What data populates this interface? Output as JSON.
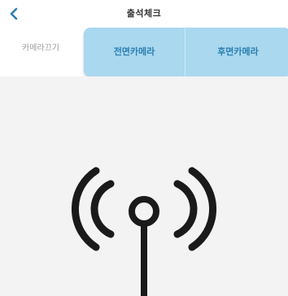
{
  "header": {
    "title": "출석체크",
    "back_icon": "chevron-left-icon"
  },
  "tabs": {
    "camera_off": "카메라끄기",
    "front_camera": "전면카메라",
    "rear_camera": "후면카메라"
  },
  "content": {
    "icon": "antenna-broadcast-icon"
  },
  "colors": {
    "accent": "#2c7fb1",
    "pill_bg": "#a9d8ef",
    "content_bg": "#f3f3f3"
  }
}
